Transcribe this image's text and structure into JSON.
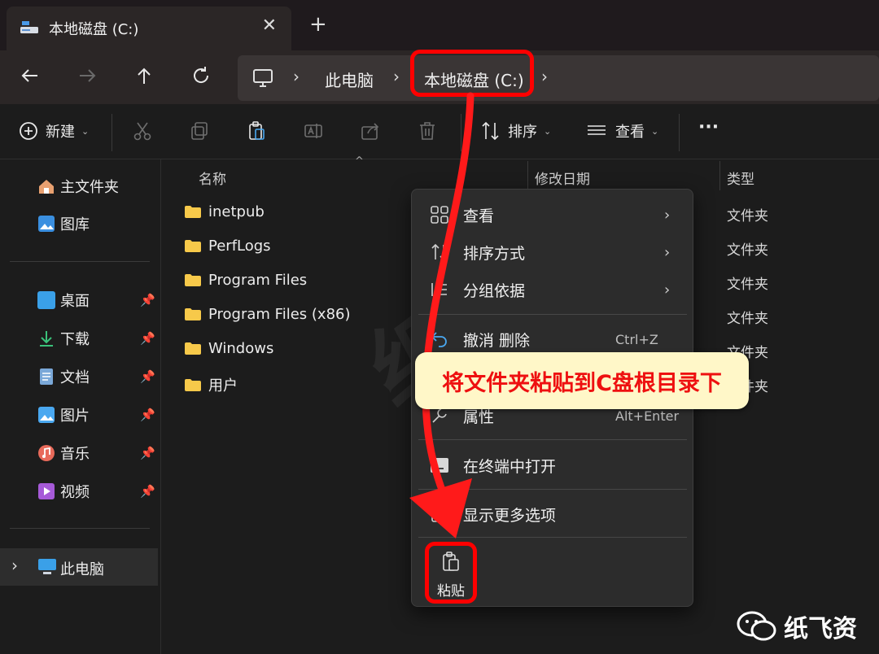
{
  "tab": {
    "title": "本地磁盘 (C:)",
    "close": "✕",
    "new": "+"
  },
  "address": {
    "crumbs": [
      "此电脑",
      "本地磁盘 (C:)"
    ],
    "sep": "›"
  },
  "toolbar": {
    "new_label": "新建",
    "sort_label": "排序",
    "view_label": "查看",
    "more": "···"
  },
  "sidebar": {
    "home": "主文件夹",
    "gallery": "图库",
    "quick": [
      {
        "label": "桌面",
        "color": "#3aa0e8"
      },
      {
        "label": "下载",
        "color": "#3ac27a"
      },
      {
        "label": "文档",
        "color": "#7aa8d8"
      },
      {
        "label": "图片",
        "color": "#4aa8f0"
      },
      {
        "label": "音乐",
        "color": "#e86a5a"
      },
      {
        "label": "视频",
        "color": "#a65ad8"
      }
    ],
    "thispc": "此电脑",
    "chevron": "›",
    "pin": "📌"
  },
  "columns": {
    "name": "名称",
    "date": "修改日期",
    "type": "类型"
  },
  "files": [
    {
      "name": "inetpub",
      "type": "文件夹"
    },
    {
      "name": "PerfLogs",
      "type": "文件夹"
    },
    {
      "name": "Program Files",
      "type": "文件夹"
    },
    {
      "name": "Program Files (x86)",
      "type": "文件夹"
    },
    {
      "name": "Windows",
      "type": "文件夹"
    },
    {
      "name": "用户",
      "type": "文件夹"
    }
  ],
  "menu": {
    "view": "查看",
    "sort": "排序方式",
    "group": "分组依据",
    "undo": "撤消 删除",
    "undo_shortcut": "Ctrl+Z",
    "properties": "属性",
    "properties_shortcut": "Alt+Enter",
    "terminal": "在终端中打开",
    "more": "显示更多选项",
    "paste": "粘贴",
    "arrow": "›"
  },
  "annotation": {
    "callout": "将文件夹粘贴到C盘根目录下"
  },
  "brand": {
    "name": "纸飞资"
  },
  "watermark": "纸飞资",
  "colors": {
    "highlight": "#ff0000",
    "callout_bg": "#fff7c8",
    "folder": "#f7c94a"
  }
}
